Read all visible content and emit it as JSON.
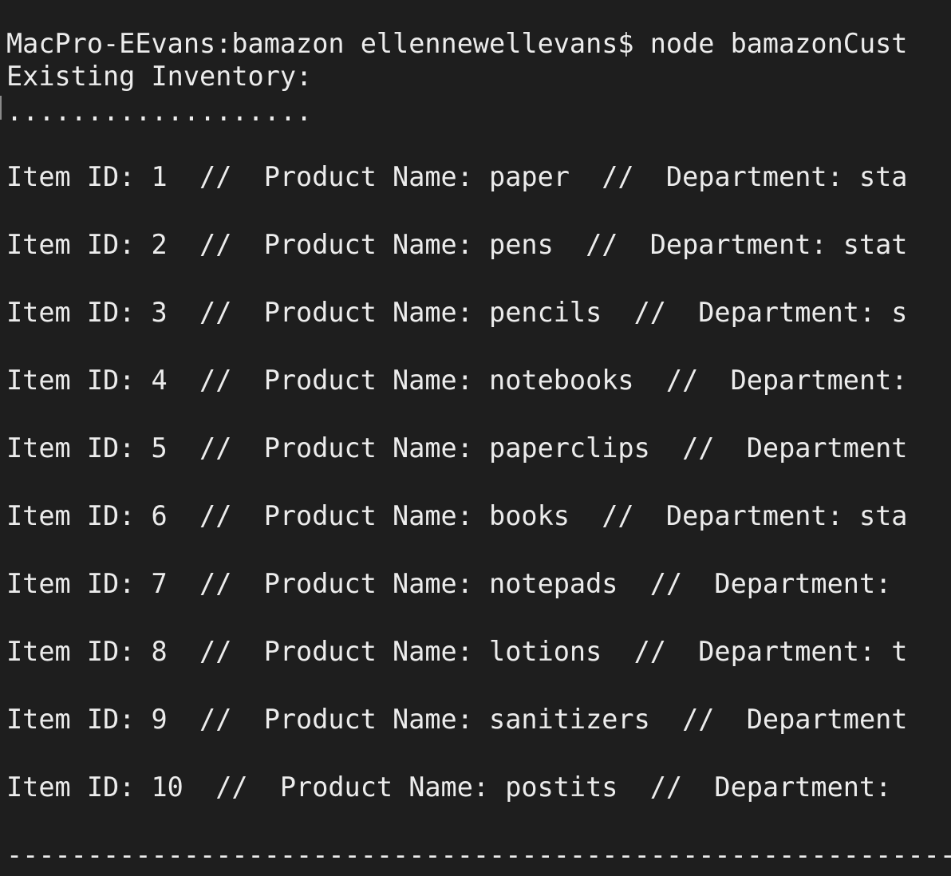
{
  "terminal": {
    "prompt_line": "MacPro-EEvans:bamazon ellennewellevans$ node bamazonCust",
    "header": "Existing Inventory:",
    "dots": "...................",
    "items": [
      "Item ID: 1  //  Product Name: paper  //  Department: sta",
      "Item ID: 2  //  Product Name: pens  //  Department: stat",
      "Item ID: 3  //  Product Name: pencils  //  Department: s",
      "Item ID: 4  //  Product Name: notebooks  //  Department:",
      "Item ID: 5  //  Product Name: paperclips  //  Department",
      "Item ID: 6  //  Product Name: books  //  Department: sta",
      "Item ID: 7  //  Product Name: notepads  //  Department:",
      "Item ID: 8  //  Product Name: lotions  //  Department: t",
      "Item ID: 9  //  Product Name: sanitizers  //  Department",
      "Item ID: 10  //  Product Name: postits  //  Department:"
    ],
    "separator": "----------------------------------------------------------------"
  }
}
